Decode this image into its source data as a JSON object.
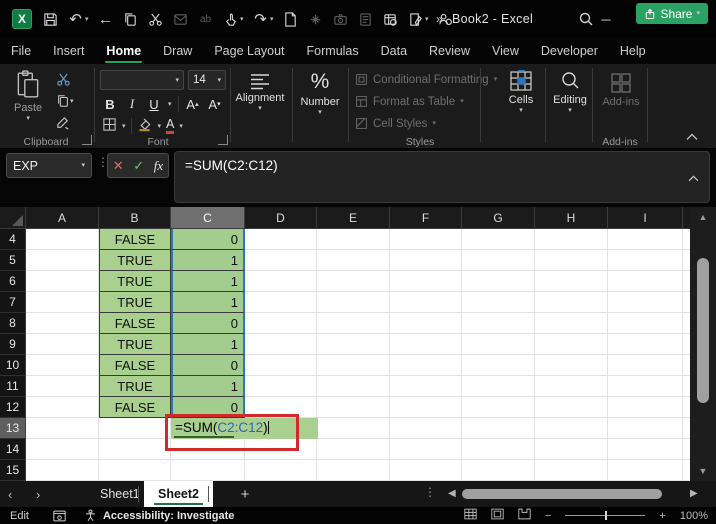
{
  "title_bar": {
    "title": "Book2 - Excel",
    "overflow": "»"
  },
  "icons": {
    "undo": "↶",
    "redo": "↷",
    "back": "←",
    "chevron_down": "▾",
    "chevron_up": "▴",
    "kebab": "⋮",
    "close": "✕",
    "cancel": "✕",
    "confirm": "✓",
    "minimize": "─",
    "prev": "‹",
    "next": "›",
    "scroll_left": "◀",
    "scroll_right": "▶",
    "scroll_up": "▲",
    "scroll_down": "▼",
    "minus": "−",
    "plus": "+",
    "replace_ab": "ab",
    "x_letter": "X"
  },
  "ribbon_tabs": {
    "items": [
      "File",
      "Insert",
      "Home",
      "Draw",
      "Page Layout",
      "Formulas",
      "Data",
      "Review",
      "View",
      "Developer",
      "Help"
    ],
    "active": "Home",
    "share_label": "Share"
  },
  "ribbon": {
    "clipboard": {
      "group_label": "Clipboard",
      "paste_label": "Paste"
    },
    "font": {
      "group_label": "Font",
      "size_value": "14",
      "bold": "B",
      "italic": "I",
      "underline": "U",
      "grow": "A",
      "shrink": "A",
      "font_color": "A"
    },
    "alignment": {
      "label": "Alignment"
    },
    "number": {
      "label": "Number",
      "percent": "%"
    },
    "styles": {
      "group_label": "Styles",
      "items": [
        "Conditional Formatting",
        "Format as Table",
        "Cell Styles"
      ]
    },
    "cells": {
      "label": "Cells"
    },
    "editing": {
      "label": "Editing"
    },
    "addins": {
      "label": "Add-ins",
      "group_label": "Add-ins"
    }
  },
  "formula_bar": {
    "name_box_value": "EXP",
    "fx_label": "fx",
    "formula_value": "=SUM(C2:C12)"
  },
  "grid": {
    "columns": [
      "A",
      "B",
      "C",
      "D",
      "E",
      "F",
      "G",
      "H",
      "I"
    ],
    "selected_column": "C",
    "active_row": "13",
    "rows": [
      {
        "n": "4",
        "b": "FALSE",
        "c": "0"
      },
      {
        "n": "5",
        "b": "TRUE",
        "c": "1"
      },
      {
        "n": "6",
        "b": "TRUE",
        "c": "1"
      },
      {
        "n": "7",
        "b": "TRUE",
        "c": "1"
      },
      {
        "n": "8",
        "b": "FALSE",
        "c": "0"
      },
      {
        "n": "9",
        "b": "TRUE",
        "c": "1"
      },
      {
        "n": "10",
        "b": "FALSE",
        "c": "0"
      },
      {
        "n": "11",
        "b": "TRUE",
        "c": "1"
      },
      {
        "n": "12",
        "b": "FALSE",
        "c": "0"
      },
      {
        "n": "13"
      },
      {
        "n": "14"
      },
      {
        "n": "15"
      }
    ],
    "editing": {
      "cell": "C13",
      "prefix": "=SUM(",
      "reference": "C2:C12",
      "suffix": ")"
    }
  },
  "sheet_bar": {
    "sheets": [
      "Sheet1",
      "Sheet2"
    ],
    "active_sheet": "Sheet2",
    "add_label": "+"
  },
  "status_bar": {
    "mode": "Edit",
    "accessibility": "Accessibility: Investigate",
    "zoom_level": "100%"
  },
  "colors": {
    "accent_green": "#21A366",
    "cell_green": "#A9D08E",
    "reference_blue": "#2E75B6",
    "annotation_red": "#D02A2A"
  }
}
